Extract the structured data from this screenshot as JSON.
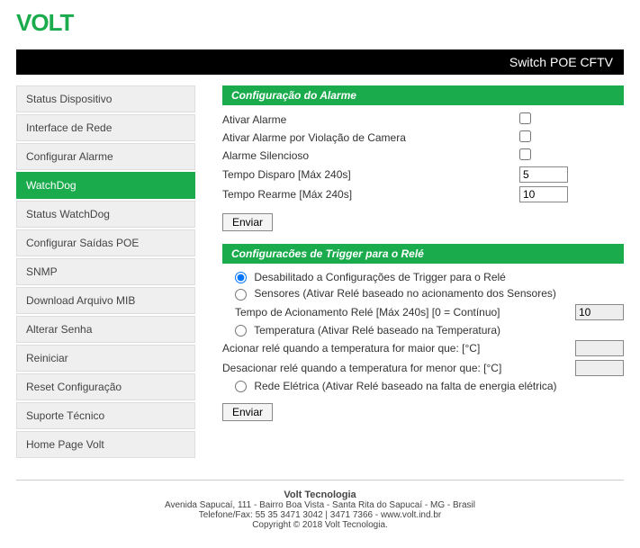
{
  "brand": "VOLT",
  "header_right": "Switch POE CFTV",
  "sidebar": {
    "items": [
      {
        "label": "Status Dispositivo"
      },
      {
        "label": "Interface de Rede"
      },
      {
        "label": "Configurar Alarme"
      },
      {
        "label": "WatchDog"
      },
      {
        "label": "Status WatchDog"
      },
      {
        "label": "Configurar Saídas POE"
      },
      {
        "label": "SNMP"
      },
      {
        "label": "Download Arquivo MIB"
      },
      {
        "label": "Alterar Senha"
      },
      {
        "label": "Reiniciar"
      },
      {
        "label": "Reset Configuração"
      },
      {
        "label": "Suporte Técnico"
      },
      {
        "label": "Home Page Volt"
      }
    ],
    "active_index": 3
  },
  "alarm": {
    "title": "Configuração do Alarme",
    "rows": {
      "ativar": "Ativar Alarme",
      "violacao": "Ativar Alarme por Violação de Camera",
      "silencioso": "Alarme Silencioso",
      "tempo_disparo_label": "Tempo Disparo [Máx 240s]",
      "tempo_disparo_value": "5",
      "tempo_rearme_label": "Tempo Rearme [Máx 240s]",
      "tempo_rearme_value": "10"
    },
    "submit": "Enviar"
  },
  "trigger": {
    "title": "Configuracões de Trigger para o Relé",
    "opt_disabled": "Desabilitado a Configurações de Trigger para o Relé",
    "opt_sensores": "Sensores (Ativar Relé baseado no acionamento dos Sensores)",
    "tempo_acionamento_label": "Tempo de Acionamento Relé [Máx 240s] [0 = Contínuo]",
    "tempo_acionamento_value": "10",
    "opt_temperatura": "Temperatura (Ativar Relé baseado na Temperatura)",
    "acionar_maior_label": "Acionar relé quando a temperatura for maior que: [°C]",
    "acionar_maior_value": "",
    "desacionar_menor_label": "Desacionar relé quando a temperatura for menor que: [°C]",
    "desacionar_menor_value": "",
    "opt_rede": "Rede Elétrica (Ativar Relé baseado na falta de energia elétrica)",
    "submit": "Enviar"
  },
  "footer": {
    "company": "Volt Tecnologia",
    "address": "Avenida Sapucaí, 111 - Bairro Boa Vista - Santa Rita do Sapucaí - MG - Brasil",
    "contact": "Telefone/Fax: 55 35 3471 3042 | 3471 7366 - www.volt.ind.br",
    "copyright": "Copyright © 2018 Volt Tecnologia."
  }
}
